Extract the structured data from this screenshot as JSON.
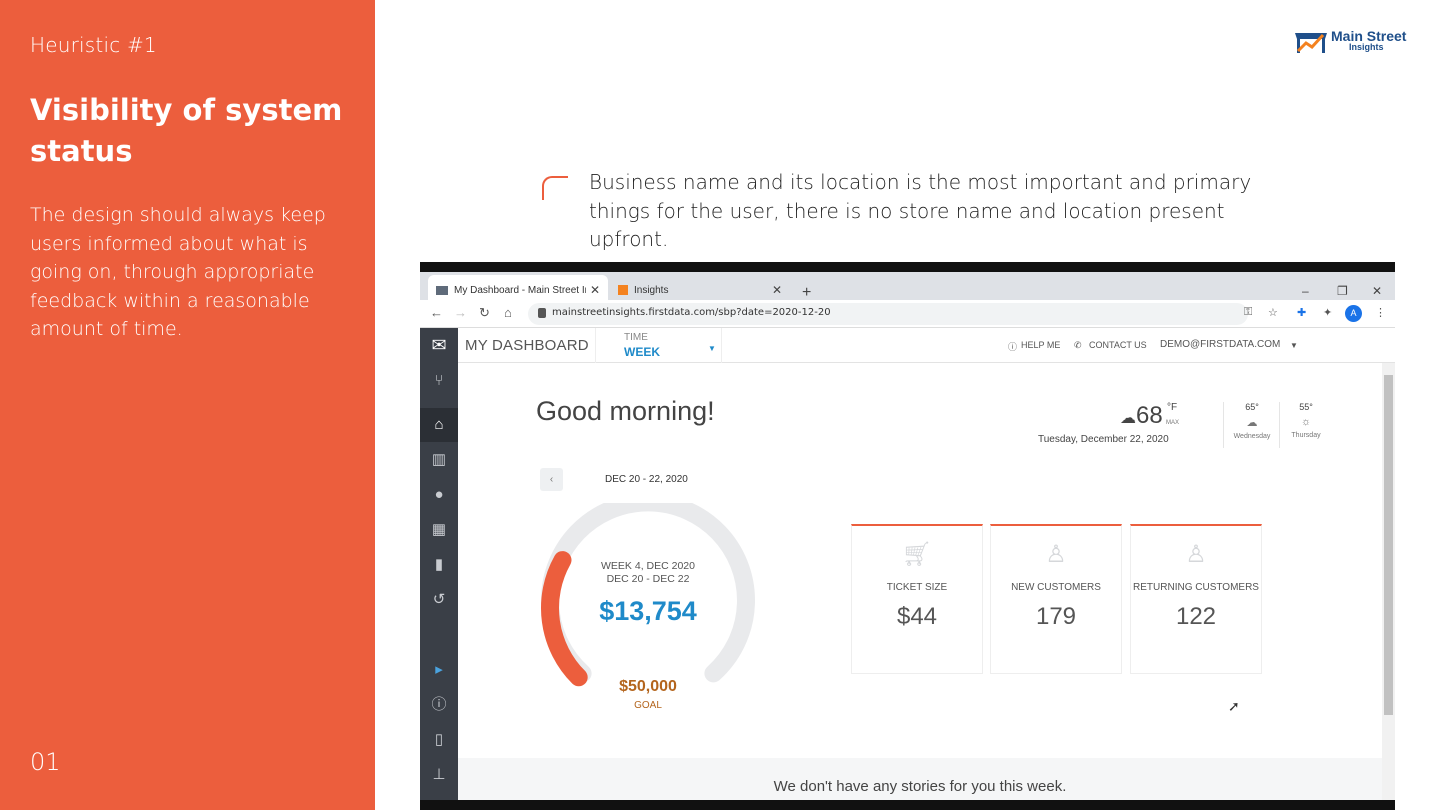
{
  "slide": {
    "heuristic_label": "Heuristic #1",
    "title": "Visibility of system status",
    "description": "The design should always keep users informed about what is going on, through appropriate feedback within a reasonable amount of time.",
    "number": "01",
    "accent_color": "#ec5e3d"
  },
  "logo": {
    "name": "Main Street",
    "sub": "Insights"
  },
  "annotation": {
    "text": "Business name and its location is the most important and primary things for the user, there is no store name and location present upfront."
  },
  "browser": {
    "tabs": [
      {
        "label": "My Dashboard - Main Street Ins",
        "close": "✕"
      },
      {
        "label": "Insights",
        "close": "✕"
      }
    ],
    "new_tab": "+",
    "window_controls": [
      "–",
      "❐",
      "✕"
    ],
    "url": "mainstreetinsights.firstdata.com/sbp?date=2020-12-20",
    "avatar": "A"
  },
  "app": {
    "title": "MY DASHBOARD",
    "time_label": "TIME",
    "time_value": "WEEK",
    "help": "HELP ME",
    "contact": "CONTACT US",
    "user": "DEMO@FIRSTDATA.COM",
    "greeting": "Good morning!",
    "weather": {
      "temp": "68",
      "unit": "°F",
      "max": "MAX",
      "date": "Tuesday, December 22, 2020",
      "forecast": [
        {
          "temp": "65°",
          "day": "Wednesday",
          "icon": "partly-cloudy-icon"
        },
        {
          "temp": "55°",
          "day": "Thursday",
          "icon": "sun-icon"
        }
      ]
    },
    "date_range": "DEC 20 - 22, 2020",
    "gauge": {
      "week": "WEEK 4, DEC 2020",
      "range": "DEC 20 - DEC 22",
      "amount": "$13,754",
      "goal": "$50,000",
      "goal_label": "GOAL",
      "progress_fraction": 0.275
    },
    "metrics": [
      {
        "label": "TICKET SIZE",
        "value": "$44",
        "icon": "cart-icon"
      },
      {
        "label": "NEW CUSTOMERS",
        "value": "179",
        "icon": "add-user-icon"
      },
      {
        "label": "RETURNING CUSTOMERS",
        "value": "122",
        "icon": "returning-user-icon"
      }
    ],
    "stories": "We don't have any stories for you this week."
  }
}
